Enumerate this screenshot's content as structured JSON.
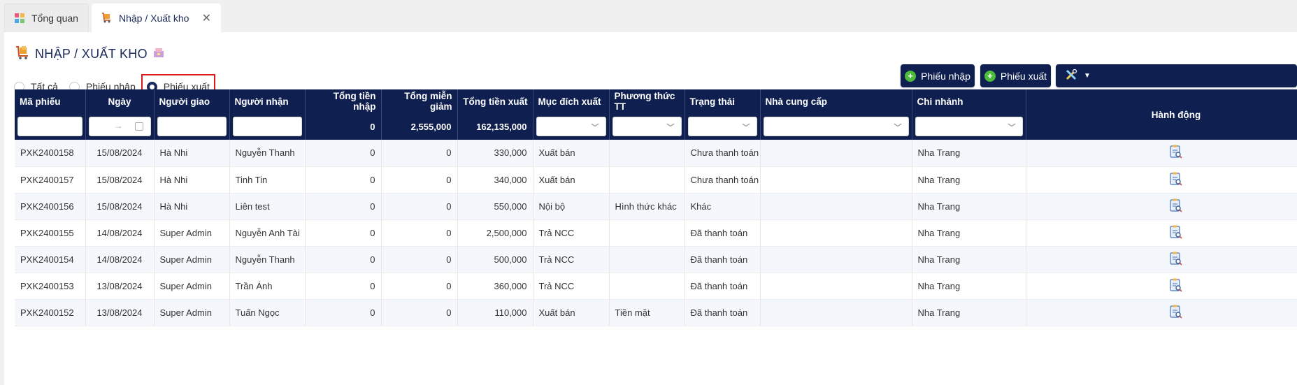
{
  "tabs": [
    {
      "label": "Tổng quan",
      "icon": "dashboard-icon"
    },
    {
      "label": "Nhập / Xuất kho",
      "icon": "cart-icon",
      "close": "✕"
    }
  ],
  "page": {
    "title": "NHẬP / XUẤT KHO"
  },
  "filters": {
    "options": [
      "Tất cả",
      "Phiếu nhập",
      "Phiếu xuất"
    ],
    "selected": "Phiếu xuất"
  },
  "actions": {
    "import_label": "Phiếu nhập",
    "export_label": "Phiếu xuất",
    "tools_icon": "tools-icon"
  },
  "table": {
    "columns": [
      "Mã phiếu",
      "Ngày",
      "Người giao",
      "Người nhận",
      "Tổng tiền nhập",
      "Tổng miễn giảm",
      "Tổng tiền xuất",
      "Mục đích xuất",
      "Phương thức TT",
      "Trạng thái",
      "Nhà cung cấp",
      "Chi nhánh",
      "Hành động"
    ],
    "date_range_arrow": "→",
    "totals": {
      "import": "0",
      "discount": "2,555,000",
      "export": "162,135,000"
    },
    "rows": [
      [
        "PXK2400158",
        "15/08/2024",
        "Hà Nhi",
        "Nguyễn Thanh",
        "0",
        "0",
        "330,000",
        "Xuất bán",
        "",
        "Chưa thanh toán",
        "",
        "Nha Trang"
      ],
      [
        "PXK2400157",
        "15/08/2024",
        "Hà Nhi",
        "Tinh Tin",
        "0",
        "0",
        "340,000",
        "Xuất bán",
        "",
        "Chưa thanh toán",
        "",
        "Nha Trang"
      ],
      [
        "PXK2400156",
        "15/08/2024",
        "Hà Nhi",
        "Liên test",
        "0",
        "0",
        "550,000",
        "Nội bộ",
        "Hình thức khác",
        "Khác",
        "",
        "Nha Trang"
      ],
      [
        "PXK2400155",
        "14/08/2024",
        "Super Admin",
        "Nguyễn Anh Tài",
        "0",
        "0",
        "2,500,000",
        "Trả NCC",
        "",
        "Đã thanh toán",
        "",
        "Nha Trang"
      ],
      [
        "PXK2400154",
        "14/08/2024",
        "Super Admin",
        "Nguyễn Thanh",
        "0",
        "0",
        "500,000",
        "Trả NCC",
        "",
        "Đã thanh toán",
        "",
        "Nha Trang"
      ],
      [
        "PXK2400153",
        "13/08/2024",
        "Super Admin",
        "Trần Ánh",
        "0",
        "0",
        "360,000",
        "Trả NCC",
        "",
        "Đã thanh toán",
        "",
        "Nha Trang"
      ],
      [
        "PXK2400152",
        "13/08/2024",
        "Super Admin",
        "Tuấn Ngọc",
        "0",
        "0",
        "110,000",
        "Xuất bán",
        "Tiền mặt",
        "Đã thanh toán",
        "",
        "Nha Trang"
      ]
    ]
  },
  "colors": {
    "header_bg": "#0f1f4f",
    "accent_green": "#4cbb3c",
    "highlight_red": "#e01a1a",
    "row_alt": "#f4f7fc"
  }
}
